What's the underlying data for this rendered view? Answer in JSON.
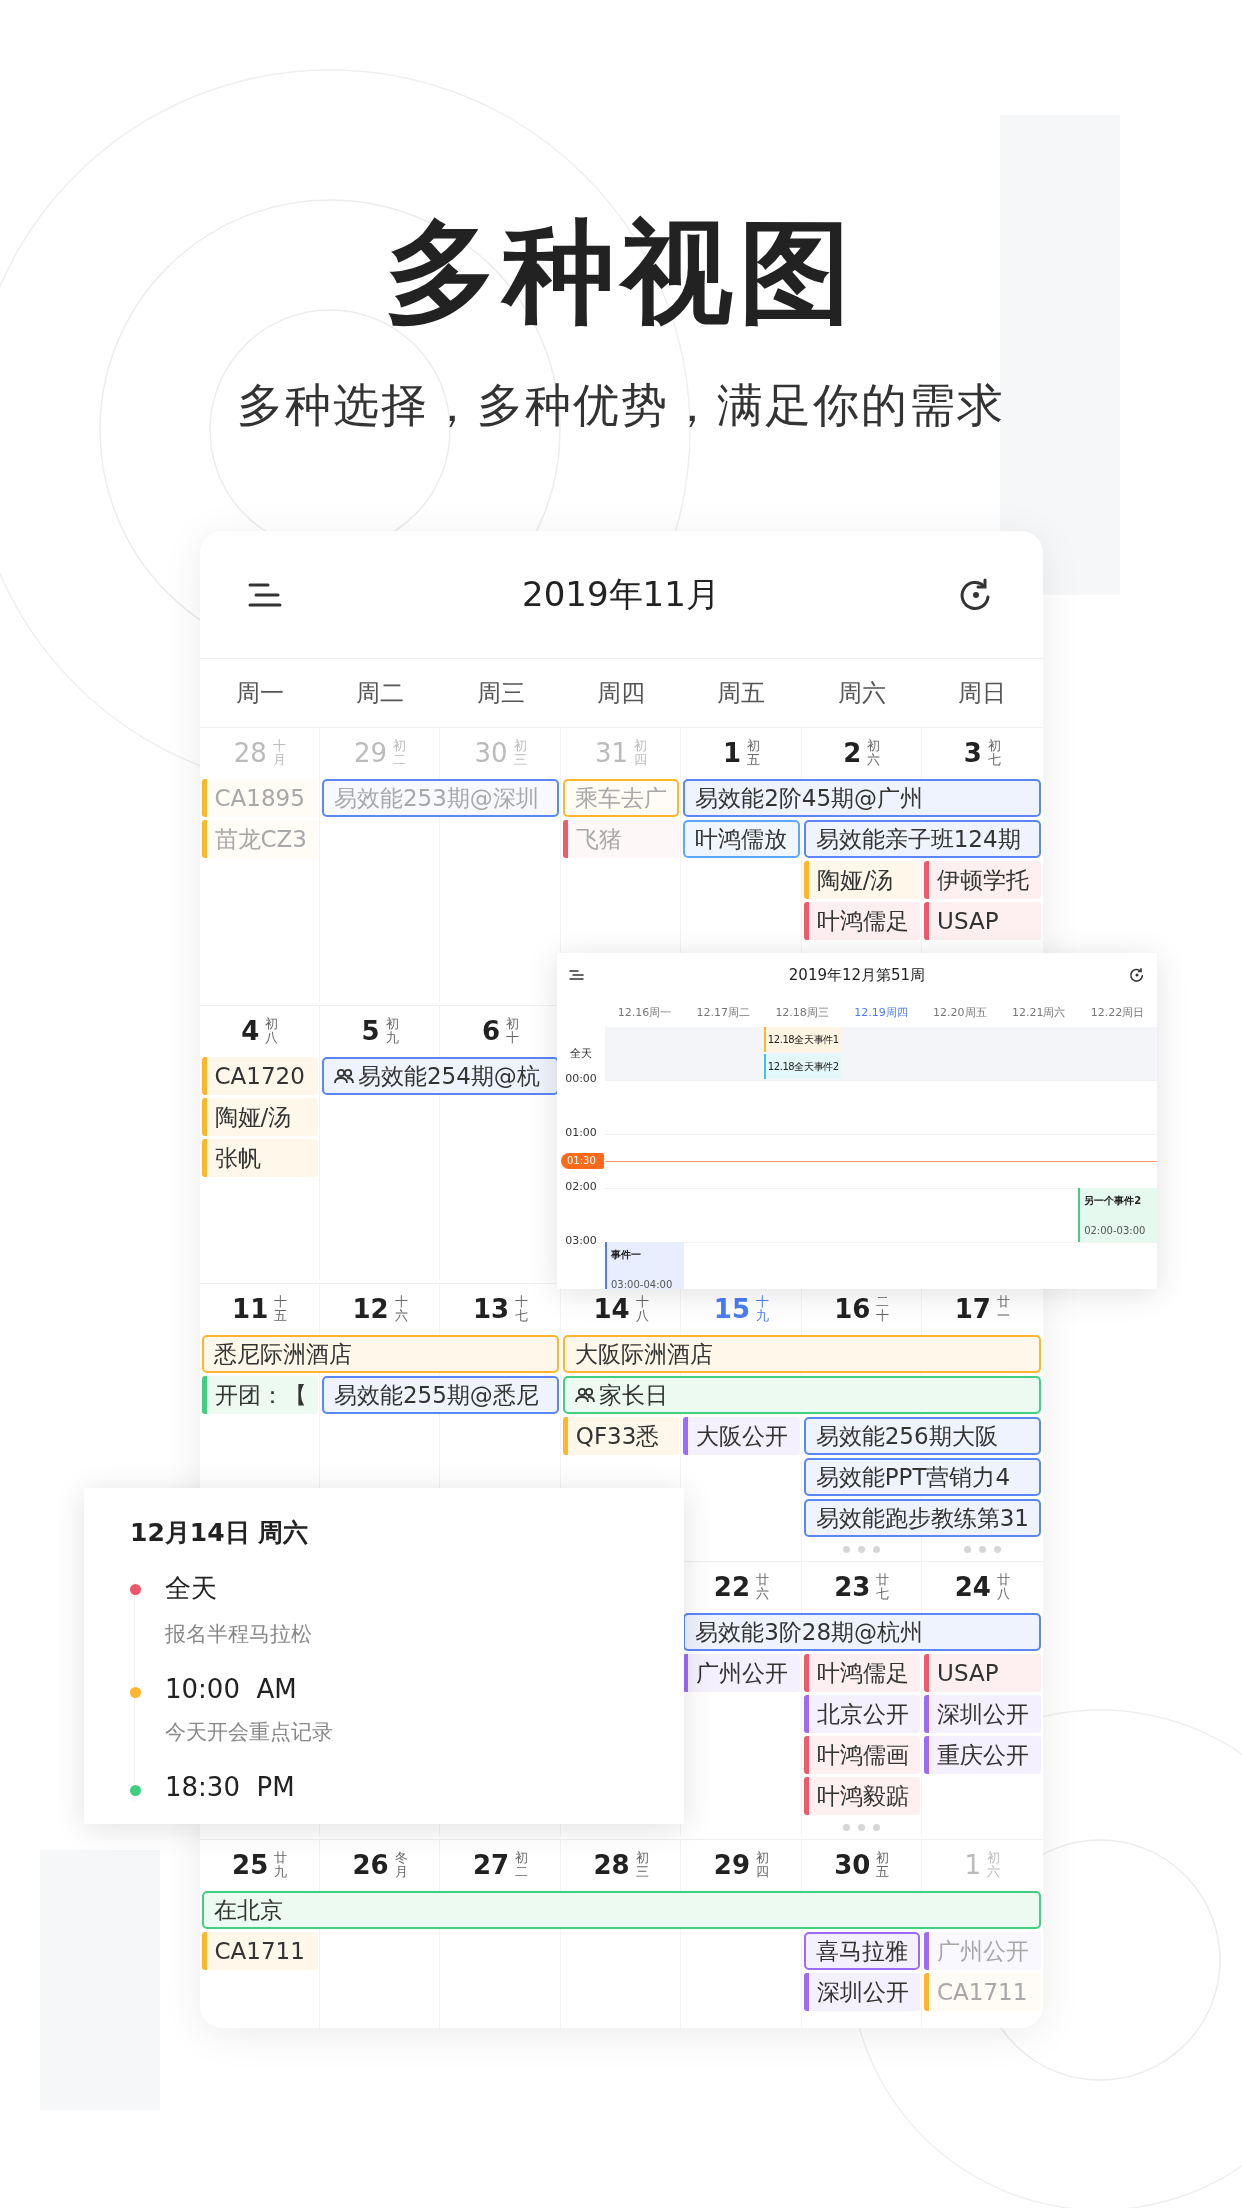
{
  "page": {
    "title": "多种视图",
    "subtitle": "多种选择，多种优势，满足你的需求"
  },
  "month_view": {
    "title": "2019年11月",
    "weekdays": [
      "周一",
      "周二",
      "周三",
      "周四",
      "周五",
      "周六",
      "周日"
    ],
    "weeks": [
      {
        "days": [
          {
            "kind": "date",
            "num": "28",
            "lunar": "十月",
            "dim": true,
            "today": false
          },
          {
            "kind": "date",
            "num": "29",
            "lunar": "初二",
            "dim": true,
            "today": false
          },
          {
            "kind": "date",
            "num": "30",
            "lunar": "初三",
            "dim": true,
            "today": false
          },
          {
            "kind": "date",
            "num": "31",
            "lunar": "初四",
            "dim": true,
            "today": false
          },
          {
            "kind": "date",
            "num": "1",
            "lunar": "初五",
            "dim": false,
            "today": false
          },
          {
            "kind": "date",
            "num": "2",
            "lunar": "初六",
            "dim": false,
            "today": false
          },
          {
            "kind": "date",
            "num": "3",
            "lunar": "初七",
            "dim": false,
            "today": false
          }
        ],
        "lanes": [
          [
            {
              "kind": "bar",
              "text": "CA1895",
              "color": "#ffb52e",
              "muted": true
            },
            {
              "kind": "box",
              "text": "易效能253期@深圳",
              "color": "#5b86f5",
              "muted": true
            },
            {
              "kind": "continued"
            },
            {
              "kind": "box",
              "text": "乘车去广",
              "color": "#ffb52e",
              "muted": true
            },
            {
              "kind": "box",
              "text": "易效能2阶45期@广州",
              "color": "#5b86f5",
              "muted": false
            },
            {
              "kind": "continued"
            },
            {
              "kind": "continued"
            }
          ],
          [
            {
              "kind": "bar",
              "text": "苗龙CZ3",
              "color": "#ffb52e",
              "muted": true
            },
            {
              "kind": "empty"
            },
            {
              "kind": "empty"
            },
            {
              "kind": "bar",
              "text": "飞猪",
              "color": "#f25a6b",
              "muted": true
            },
            {
              "kind": "box",
              "text": "叶鸿儒放",
              "color": "#5aa8ff",
              "muted": false
            },
            {
              "kind": "box",
              "text": "易效能亲子班124期",
              "color": "#5b86f5",
              "muted": false
            },
            {
              "kind": "continued"
            }
          ],
          [
            {
              "kind": "empty"
            },
            {
              "kind": "empty"
            },
            {
              "kind": "empty"
            },
            {
              "kind": "empty"
            },
            {
              "kind": "empty"
            },
            {
              "kind": "bar",
              "text": "陶娅/汤",
              "color": "#ffb52e",
              "muted": false
            },
            {
              "kind": "bar",
              "text": "伊顿学托",
              "color": "#f25a6b",
              "muted": false
            }
          ],
          [
            {
              "kind": "empty"
            },
            {
              "kind": "empty"
            },
            {
              "kind": "empty"
            },
            {
              "kind": "empty"
            },
            {
              "kind": "empty"
            },
            {
              "kind": "bar",
              "text": "叶鸿儒足",
              "color": "#f25a6b",
              "muted": false
            },
            {
              "kind": "bar",
              "text": "USAP",
              "color": "#f25a6b",
              "muted": false
            }
          ]
        ]
      },
      {
        "days": [
          {
            "kind": "date",
            "num": "4",
            "lunar": "初八",
            "dim": false,
            "today": false
          },
          {
            "kind": "date",
            "num": "5",
            "lunar": "初九",
            "dim": false,
            "today": false
          },
          {
            "kind": "date",
            "num": "6",
            "lunar": "初十",
            "dim": false,
            "today": false
          },
          {
            "kind": "covered"
          },
          {
            "kind": "covered"
          },
          {
            "kind": "covered"
          },
          {
            "kind": "covered"
          }
        ],
        "lanes": [
          [
            {
              "kind": "bar",
              "text": "CA1720",
              "color": "#ffb52e",
              "muted": false
            },
            {
              "kind": "group",
              "text": "易效能254期@杭",
              "color": "#5b86f5",
              "muted": false
            },
            {
              "kind": "continued"
            }
          ],
          [
            {
              "kind": "bar",
              "text": "陶娅/汤",
              "color": "#ffb52e",
              "muted": false
            }
          ],
          [
            {
              "kind": "bar",
              "text": "张帆",
              "color": "#ffb52e",
              "muted": false
            }
          ]
        ]
      },
      {
        "days": [
          {
            "kind": "date",
            "num": "11",
            "lunar": "十五",
            "dim": false,
            "today": false
          },
          {
            "kind": "date",
            "num": "12",
            "lunar": "十六",
            "dim": false,
            "today": false
          },
          {
            "kind": "date",
            "num": "13",
            "lunar": "十七",
            "dim": false,
            "today": false
          },
          {
            "kind": "date",
            "num": "14",
            "lunar": "十八",
            "dim": false,
            "today": false
          },
          {
            "kind": "date",
            "num": "15",
            "lunar": "十九",
            "dim": false,
            "today": true
          },
          {
            "kind": "date",
            "num": "16",
            "lunar": "二十",
            "dim": false,
            "today": false
          },
          {
            "kind": "date",
            "num": "17",
            "lunar": "廿一",
            "dim": false,
            "today": false
          }
        ],
        "lanes": [
          [
            {
              "kind": "box",
              "text": "悉尼际洲酒店",
              "color": "#ffb52e",
              "muted": false
            },
            {
              "kind": "continued"
            },
            {
              "kind": "continued"
            },
            {
              "kind": "box",
              "text": "大阪际洲酒店",
              "color": "#ffb52e",
              "muted": false
            },
            {
              "kind": "continued"
            },
            {
              "kind": "continued"
            },
            {
              "kind": "continued"
            }
          ],
          [
            {
              "kind": "bar",
              "text": "开团：【",
              "color": "#40d080",
              "muted": false
            },
            {
              "kind": "box",
              "text": "易效能255期@悉尼",
              "color": "#5b86f5",
              "muted": false
            },
            {
              "kind": "continued"
            },
            {
              "kind": "group",
              "text": "家长日",
              "color": "#40d080",
              "muted": false
            },
            {
              "kind": "continued"
            },
            {
              "kind": "continued"
            },
            {
              "kind": "continued"
            }
          ],
          [
            {
              "kind": "empty"
            },
            {
              "kind": "empty"
            },
            {
              "kind": "empty"
            },
            {
              "kind": "bar",
              "text": "QF33悉",
              "color": "#ffb52e",
              "muted": false
            },
            {
              "kind": "bar",
              "text": "大阪公开",
              "color": "#9d6cf5",
              "muted": false
            },
            {
              "kind": "box",
              "text": "易效能256期大阪",
              "color": "#5b86f5",
              "muted": false
            },
            {
              "kind": "continued"
            }
          ],
          [
            {
              "kind": "empty"
            },
            {
              "kind": "empty"
            },
            {
              "kind": "empty"
            },
            {
              "kind": "empty"
            },
            {
              "kind": "empty"
            },
            {
              "kind": "box",
              "text": "易效能PPT营销力4",
              "color": "#5b86f5",
              "muted": false
            },
            {
              "kind": "continued"
            }
          ],
          [
            {
              "kind": "empty"
            },
            {
              "kind": "empty"
            },
            {
              "kind": "empty"
            },
            {
              "kind": "empty"
            },
            {
              "kind": "empty"
            },
            {
              "kind": "box",
              "text": "易效能跑步教练第31",
              "color": "#5b86f5",
              "muted": false
            },
            {
              "kind": "continued"
            }
          ],
          [
            {
              "kind": "empty"
            },
            {
              "kind": "empty"
            },
            {
              "kind": "empty"
            },
            {
              "kind": "empty"
            },
            {
              "kind": "empty"
            },
            {
              "kind": "more"
            },
            {
              "kind": "more"
            }
          ]
        ]
      },
      {
        "days": [
          {
            "kind": "covered"
          },
          {
            "kind": "covered"
          },
          {
            "kind": "covered"
          },
          {
            "kind": "covered"
          },
          {
            "kind": "date",
            "num": "22",
            "lunar": "廿六",
            "dim": false,
            "today": false
          },
          {
            "kind": "date",
            "num": "23",
            "lunar": "廿七",
            "dim": false,
            "today": false
          },
          {
            "kind": "date",
            "num": "24",
            "lunar": "廿八",
            "dim": false,
            "today": false
          }
        ],
        "lanes": [
          [
            {
              "kind": "empty"
            },
            {
              "kind": "empty"
            },
            {
              "kind": "empty"
            },
            {
              "kind": "empty"
            },
            {
              "kind": "box",
              "text": "易效能3阶28期@杭州",
              "color": "#5b86f5",
              "muted": false
            },
            {
              "kind": "continued"
            },
            {
              "kind": "continued"
            }
          ],
          [
            {
              "kind": "empty"
            },
            {
              "kind": "empty"
            },
            {
              "kind": "empty"
            },
            {
              "kind": "empty"
            },
            {
              "kind": "bar",
              "text": "广州公开",
              "color": "#9d6cf5",
              "muted": false
            },
            {
              "kind": "bar",
              "text": "叶鸿儒足",
              "color": "#f25a6b",
              "muted": false
            },
            {
              "kind": "bar",
              "text": "USAP",
              "color": "#f25a6b",
              "muted": false
            }
          ],
          [
            {
              "kind": "empty"
            },
            {
              "kind": "empty"
            },
            {
              "kind": "empty"
            },
            {
              "kind": "empty"
            },
            {
              "kind": "empty"
            },
            {
              "kind": "bar",
              "text": "北京公开",
              "color": "#9d6cf5",
              "muted": false
            },
            {
              "kind": "bar",
              "text": "深圳公开",
              "color": "#9d6cf5",
              "muted": false
            }
          ],
          [
            {
              "kind": "empty"
            },
            {
              "kind": "empty"
            },
            {
              "kind": "empty"
            },
            {
              "kind": "empty"
            },
            {
              "kind": "empty"
            },
            {
              "kind": "bar",
              "text": "叶鸿儒画",
              "color": "#f25a6b",
              "muted": false
            },
            {
              "kind": "bar",
              "text": "重庆公开",
              "color": "#9d6cf5",
              "muted": false
            }
          ],
          [
            {
              "kind": "empty"
            },
            {
              "kind": "empty"
            },
            {
              "kind": "empty"
            },
            {
              "kind": "empty"
            },
            {
              "kind": "empty"
            },
            {
              "kind": "bar",
              "text": "叶鸿毅踮",
              "color": "#f25a6b",
              "muted": false
            }
          ],
          [
            {
              "kind": "empty"
            },
            {
              "kind": "empty"
            },
            {
              "kind": "empty"
            },
            {
              "kind": "empty"
            },
            {
              "kind": "empty"
            },
            {
              "kind": "more"
            }
          ]
        ]
      },
      {
        "days": [
          {
            "kind": "date",
            "num": "25",
            "lunar": "廿九",
            "dim": false,
            "today": false
          },
          {
            "kind": "date",
            "num": "26",
            "lunar": "冬月",
            "dim": false,
            "today": false
          },
          {
            "kind": "date",
            "num": "27",
            "lunar": "初二",
            "dim": false,
            "today": false
          },
          {
            "kind": "date",
            "num": "28",
            "lunar": "初三",
            "dim": false,
            "today": false
          },
          {
            "kind": "date",
            "num": "29",
            "lunar": "初四",
            "dim": false,
            "today": false
          },
          {
            "kind": "date",
            "num": "30",
            "lunar": "初五",
            "dim": false,
            "today": false
          },
          {
            "kind": "date",
            "num": "1",
            "lunar": "初六",
            "dim": true,
            "today": false
          }
        ],
        "lanes": [
          [
            {
              "kind": "box",
              "text": "在北京",
              "color": "#40d080",
              "muted": false
            },
            {
              "kind": "continued"
            },
            {
              "kind": "continued"
            },
            {
              "kind": "continued"
            },
            {
              "kind": "continued"
            },
            {
              "kind": "continued"
            },
            {
              "kind": "continued"
            }
          ],
          [
            {
              "kind": "bar",
              "text": "CA1711",
              "color": "#ffb52e",
              "muted": false
            },
            {
              "kind": "empty"
            },
            {
              "kind": "empty"
            },
            {
              "kind": "empty"
            },
            {
              "kind": "empty"
            },
            {
              "kind": "box",
              "text": "喜马拉雅",
              "color": "#9d6cf5",
              "muted": false
            },
            {
              "kind": "bar",
              "text": "广州公开",
              "color": "#9d6cf5",
              "muted": true
            }
          ],
          [
            {
              "kind": "empty"
            },
            {
              "kind": "empty"
            },
            {
              "kind": "empty"
            },
            {
              "kind": "empty"
            },
            {
              "kind": "empty"
            },
            {
              "kind": "bar",
              "text": "深圳公开",
              "color": "#9d6cf5",
              "muted": false
            },
            {
              "kind": "bar",
              "text": "CA1711",
              "color": "#ffb52e",
              "muted": true
            }
          ]
        ]
      }
    ]
  },
  "week_view": {
    "title": "2019年12月第51周",
    "all_day_label": "全天",
    "days": [
      {
        "label": "12.16周一",
        "selected": false,
        "slots": [
          {
            "kind": "free"
          },
          {
            "kind": "free"
          },
          {
            "kind": "free"
          },
          {
            "kind": "event",
            "title": "事件一",
            "time": "03:00-04:00",
            "color": "#4e7cf6"
          }
        ]
      },
      {
        "label": "12.17周二",
        "selected": false
      },
      {
        "label": "12.18周三",
        "selected": false,
        "all_day": [
          {
            "text": "12.18全天事件1",
            "color": "#ffb52e"
          },
          {
            "text": "12.18全天事件2",
            "color": "#3cc8d8"
          }
        ]
      },
      {
        "label": "12.19周四",
        "selected": true
      },
      {
        "label": "12.20周五",
        "selected": false
      },
      {
        "label": "12.21周六",
        "selected": false
      },
      {
        "label": "12.22周日",
        "selected": false,
        "slots": [
          {
            "kind": "free"
          },
          {
            "kind": "free"
          },
          {
            "kind": "event",
            "title": "另一个事件2",
            "time": "02:00-03:00",
            "color": "#40d080"
          }
        ]
      }
    ],
    "hours": [
      {
        "label": "00:00"
      },
      {
        "label": "01:00",
        "now": "01:30"
      },
      {
        "label": "02:00"
      },
      {
        "label": "03:00"
      }
    ]
  },
  "day_popup": {
    "title": "12月14日 周六",
    "items": [
      {
        "time": "全天",
        "note": "报名半程马拉松",
        "color": "#f0566a"
      },
      {
        "time": "10:00  AM",
        "note": "今天开会重点记录",
        "color": "#ffb52e"
      },
      {
        "time": "18:30  PM",
        "color": "#3fcf7f"
      }
    ]
  }
}
